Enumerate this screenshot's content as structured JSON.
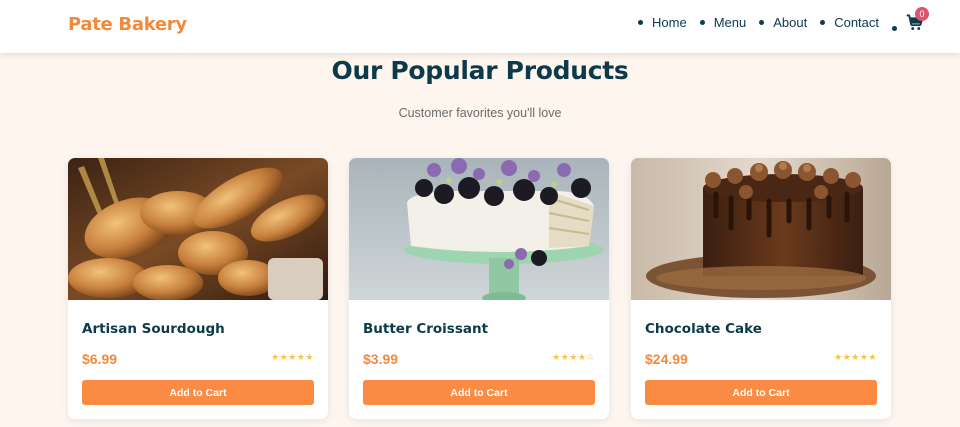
{
  "brand": {
    "name": "Pate Bakery",
    "color": "#f28a3c"
  },
  "nav": {
    "items": [
      {
        "label": "Home"
      },
      {
        "label": "Menu"
      },
      {
        "label": "About"
      },
      {
        "label": "Contact"
      }
    ],
    "cart": {
      "icon": "cart-icon",
      "count": "0",
      "badge_color": "#e0536b"
    }
  },
  "section": {
    "title": "Our Popular Products",
    "subtitle": "Customer favorites you'll love"
  },
  "products": [
    {
      "name": "Artisan Sourdough",
      "price": "$6.99",
      "rating": 5,
      "stars": "★★★★★",
      "button": "Add to Cart"
    },
    {
      "name": "Butter Croissant",
      "price": "$3.99",
      "rating": 4,
      "stars": "★★★★☆",
      "button": "Add to Cart"
    },
    {
      "name": "Chocolate Cake",
      "price": "$24.99",
      "rating": 5,
      "stars": "★★★★★",
      "button": "Add to Cart"
    }
  ],
  "colors": {
    "accent": "#fb8a42",
    "heading": "#0c3a4a",
    "background": "#fdf5ee",
    "star": "#f3c24a"
  }
}
